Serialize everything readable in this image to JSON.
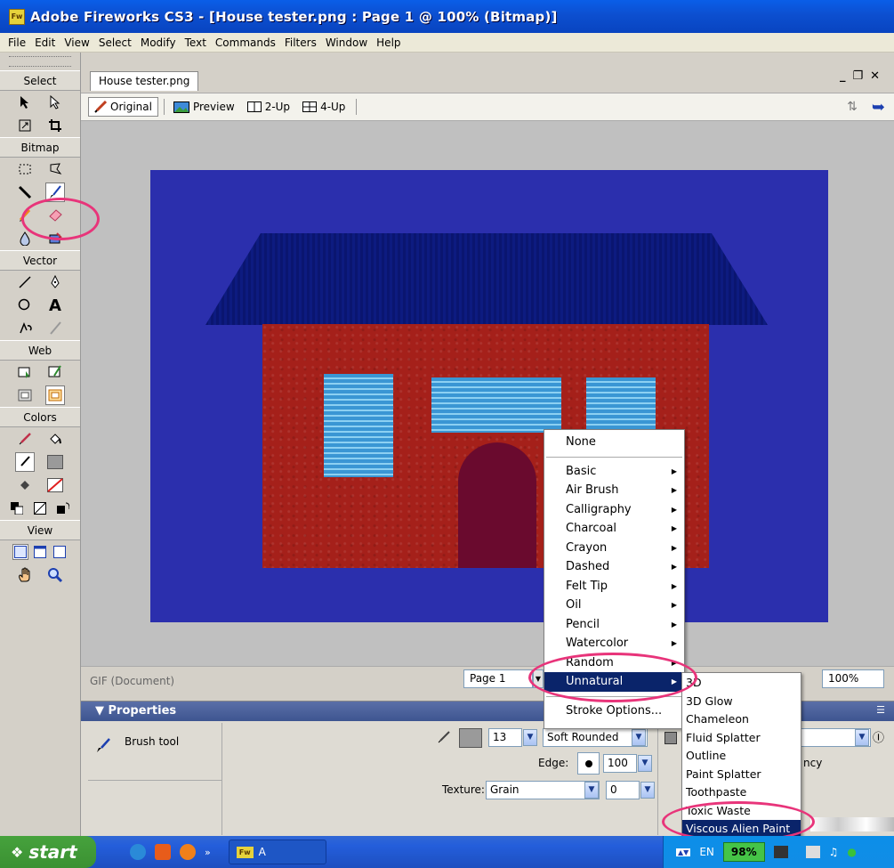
{
  "titlebar": {
    "app_icon": "Fw",
    "title": "Adobe Fireworks CS3 - [House tester.png : Page 1 @ 100% (Bitmap)]"
  },
  "menubar": [
    "File",
    "Edit",
    "View",
    "Select",
    "Modify",
    "Text",
    "Commands",
    "Filters",
    "Window",
    "Help"
  ],
  "tools": {
    "select": "Select",
    "bitmap": "Bitmap",
    "vector": "Vector",
    "web": "Web",
    "colors": "Colors",
    "view": "View"
  },
  "document": {
    "tab": "House tester.png",
    "views": [
      "Original",
      "Preview",
      "2-Up",
      "4-Up"
    ],
    "format": "GIF (Document)",
    "page": "Page 1",
    "zoom": "100%",
    "colors": {
      "background": "#2b2fad",
      "roof": "#0c1a7d",
      "wall": "#a5201a",
      "window": "#3a96d4",
      "door": "#6a0a2e"
    }
  },
  "properties": {
    "title": "▼ Properties",
    "tool_name": "Brush tool",
    "size": "13",
    "tip": "Soft Rounded",
    "edge_label": "Edge:",
    "edge_value": "100",
    "texture_label": "Texture:",
    "texture_value": "Grain",
    "texture_amount": "0",
    "transparency_partial": "ncy"
  },
  "stroke_menu": {
    "none": "None",
    "items": [
      "Basic",
      "Air Brush",
      "Calligraphy",
      "Charcoal",
      "Crayon",
      "Dashed",
      "Felt Tip",
      "Oil",
      "Pencil",
      "Watercolor",
      "Random",
      "Unnatural"
    ],
    "highlighted": "Unnatural",
    "options": "Stroke Options..."
  },
  "unnatural_submenu": {
    "items": [
      "3D",
      "3D Glow",
      "Chameleon",
      "Fluid Splatter",
      "Outline",
      "Paint Splatter",
      "Toothpaste",
      "Toxic Waste",
      "Viscous Alien Paint"
    ],
    "highlighted": "Viscous Alien Paint"
  },
  "taskbar": {
    "start": "start",
    "task_label": "A",
    "language": "EN",
    "battery": "98%"
  }
}
